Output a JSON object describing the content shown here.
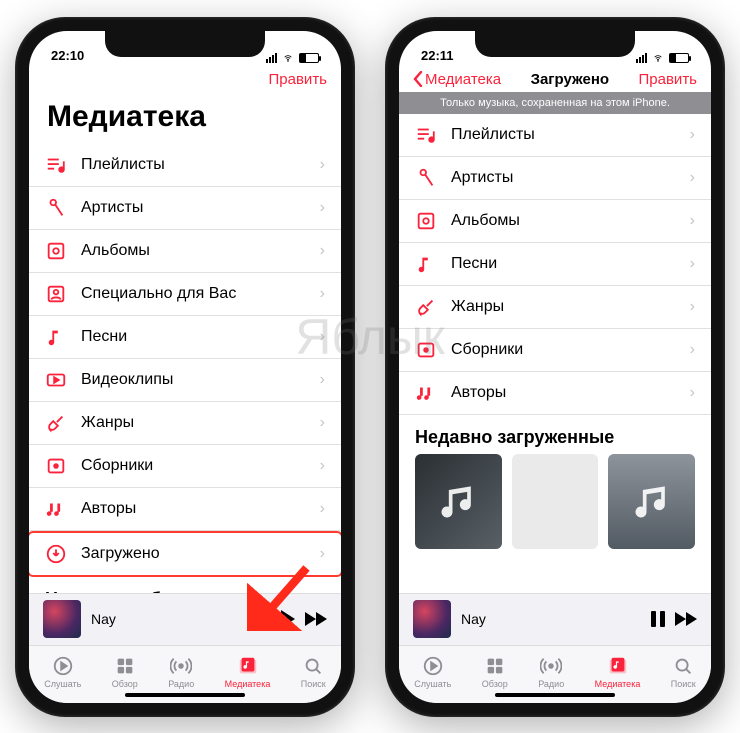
{
  "watermark": "Яблык",
  "status": {
    "time_left": "22:10",
    "time_right": "22:11"
  },
  "accent": "#fa233b",
  "left": {
    "nav": {
      "edit": "Править"
    },
    "large_title": "Медиатека",
    "rows": [
      {
        "icon": "playlist",
        "label": "Плейлисты"
      },
      {
        "icon": "mic",
        "label": "Артисты"
      },
      {
        "icon": "album",
        "label": "Альбомы"
      },
      {
        "icon": "foryou",
        "label": "Специально для Вас"
      },
      {
        "icon": "note",
        "label": "Песни"
      },
      {
        "icon": "video",
        "label": "Видеоклипы"
      },
      {
        "icon": "guitar",
        "label": "Жанры"
      },
      {
        "icon": "compilation",
        "label": "Сборники"
      },
      {
        "icon": "authors",
        "label": "Авторы"
      },
      {
        "icon": "download",
        "label": "Загружено",
        "highlight": true
      }
    ],
    "recent_title": "Недавно добавленные",
    "nowplaying": {
      "title": "Nay"
    }
  },
  "right": {
    "nav": {
      "back": "Медиатека",
      "title": "Загружено",
      "edit": "Править"
    },
    "banner": "Только музыка, сохраненная на этом iPhone.",
    "rows": [
      {
        "icon": "playlist",
        "label": "Плейлисты"
      },
      {
        "icon": "mic",
        "label": "Артисты"
      },
      {
        "icon": "album",
        "label": "Альбомы"
      },
      {
        "icon": "note",
        "label": "Песни"
      },
      {
        "icon": "guitar",
        "label": "Жанры"
      },
      {
        "icon": "compilation",
        "label": "Сборники"
      },
      {
        "icon": "authors",
        "label": "Авторы"
      }
    ],
    "recent_title": "Недавно загруженные",
    "nowplaying": {
      "title": "Nay"
    }
  },
  "tabs": [
    {
      "id": "listen",
      "label": "Слушать",
      "icon": "play-circle"
    },
    {
      "id": "browse",
      "label": "Обзор",
      "icon": "grid"
    },
    {
      "id": "radio",
      "label": "Радио",
      "icon": "radio"
    },
    {
      "id": "library",
      "label": "Медиатека",
      "icon": "library",
      "active": true
    },
    {
      "id": "search",
      "label": "Поиск",
      "icon": "search"
    }
  ]
}
